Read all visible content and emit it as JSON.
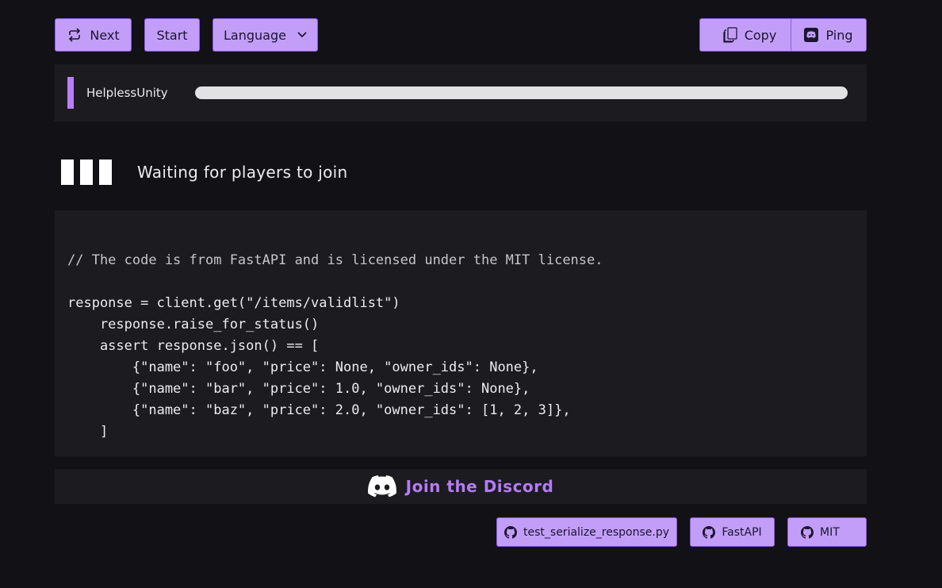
{
  "toolbar": {
    "next_label": "Next",
    "start_label": "Start",
    "language_label": "Language",
    "copy_label": "Copy",
    "ping_label": "Ping"
  },
  "player": {
    "name": "HelplessUnity",
    "progress": 0
  },
  "status": {
    "text": "Waiting for players to join"
  },
  "code": {
    "lines": [
      "// The code is from FastAPI and is licensed under the MIT license.",
      "",
      "response = client.get(\"/items/validlist\")",
      "    response.raise_for_status()",
      "    assert response.json() == [",
      "        {\"name\": \"foo\", \"price\": None, \"owner_ids\": None},",
      "        {\"name\": \"bar\", \"price\": 1.0, \"owner_ids\": None},",
      "        {\"name\": \"baz\", \"price\": 2.0, \"owner_ids\": [1, 2, 3]},",
      "    ]"
    ]
  },
  "discord": {
    "label": "Join the Discord",
    "icon": "discord-icon"
  },
  "links": {
    "file_label": "test_serialize_response.py",
    "fastapi_label": "FastAPI",
    "mit_label": "MIT",
    "icon": "github-icon"
  },
  "colors": {
    "background": "#121116",
    "panel": "#1c1b20",
    "accent": "#b880f5",
    "button": "#c39ef8"
  }
}
